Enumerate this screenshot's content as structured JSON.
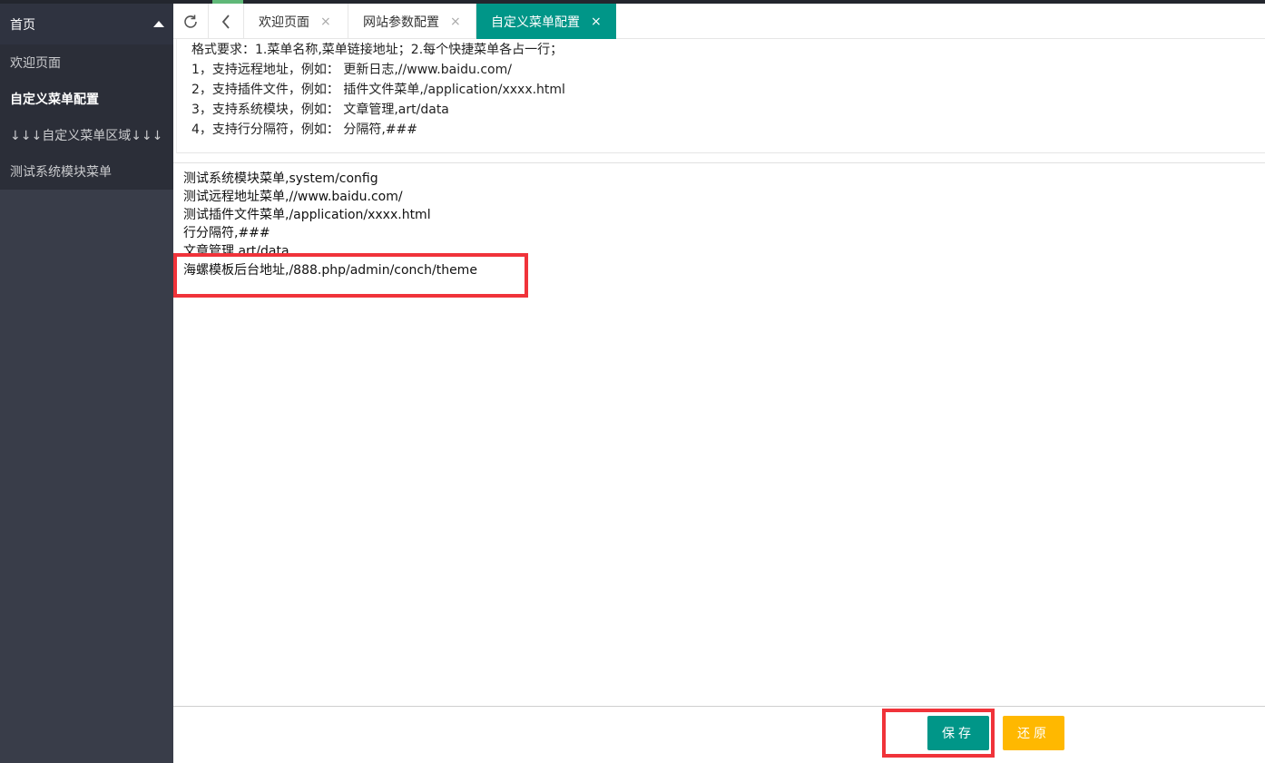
{
  "sidebar": {
    "header_label": "首页",
    "items": [
      {
        "label": "欢迎页面"
      },
      {
        "label": "自定义菜单配置"
      },
      {
        "label": "↓↓↓自定义菜单区域↓↓↓"
      },
      {
        "label": "测试系统模块菜单"
      }
    ]
  },
  "tabs": [
    {
      "label": "欢迎页面",
      "close": "×"
    },
    {
      "label": "网站参数配置",
      "close": "×"
    },
    {
      "label": "自定义菜单配置",
      "close": "×"
    }
  ],
  "help": {
    "lines": [
      "格式要求：1.菜单名称,菜单链接地址；2.每个快捷菜单各占一行；",
      "1，支持远程地址，例如： 更新日志,//www.baidu.com/",
      "2，支持插件文件，例如： 插件文件菜单,/application/xxxx.html",
      "3，支持系统模块，例如： 文章管理,art/data",
      "4，支持行分隔符，例如： 分隔符,###"
    ]
  },
  "editor": {
    "lines": [
      "测试系统模块菜单,system/config",
      "测试远程地址菜单,//www.baidu.com/",
      "测试插件文件菜单,/application/xxxx.html",
      "行分隔符,###",
      "文章管理,art/data",
      "海螺模板后台地址,/888.php/admin/conch/theme"
    ]
  },
  "buttons": {
    "save": "保存",
    "reset": "还原"
  },
  "colors": {
    "sidebar_bg": "#393d49",
    "active_tab": "#009688",
    "save_button": "#009688",
    "reset_button": "#ffb800",
    "highlight_box": "#f0333a"
  },
  "icons": {
    "refresh": "refresh-icon",
    "back": "chevron-left-icon",
    "collapse": "caret-up-icon",
    "close": "close-icon"
  }
}
